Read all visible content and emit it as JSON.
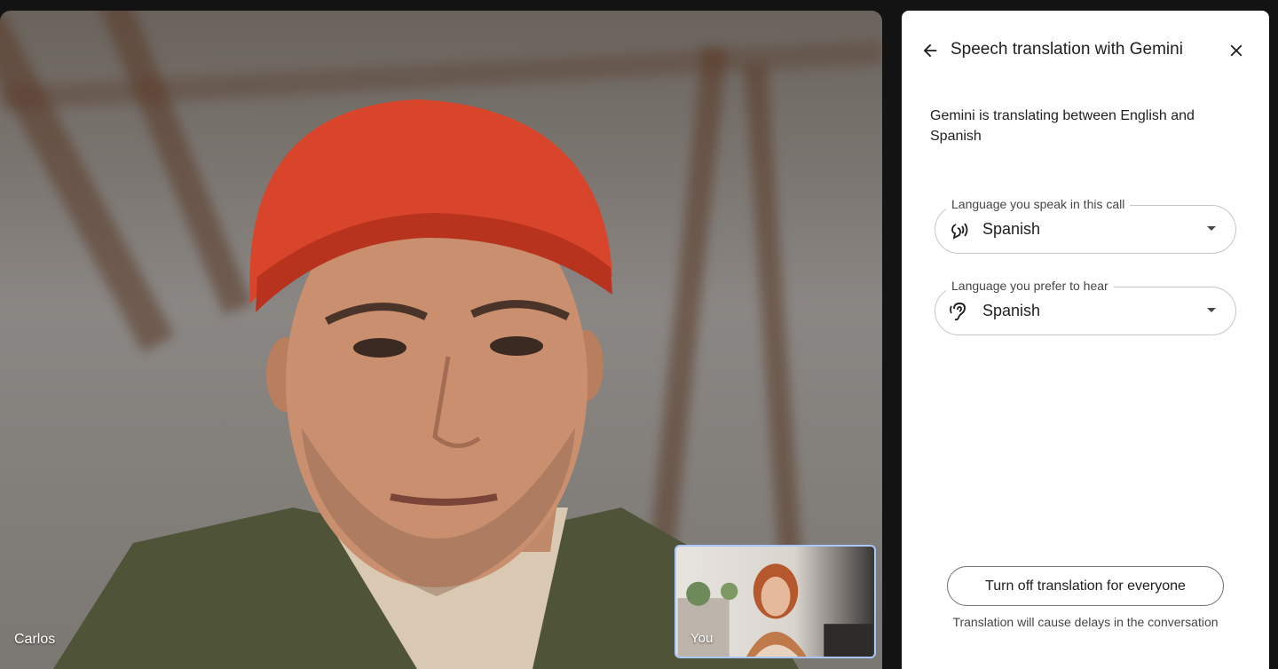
{
  "main_tile": {
    "name": "Carlos"
  },
  "self_tile": {
    "name": "You"
  },
  "panel": {
    "back_icon": "arrow-back-icon",
    "title": "Speech translation with Gemini",
    "close_icon": "close-icon",
    "description": "Gemini is translating between English and Spanish",
    "speak_field": {
      "label": "Language you speak in this call",
      "icon": "speaking-icon",
      "value": "Spanish"
    },
    "hear_field": {
      "label": "Language you prefer to hear",
      "icon": "hearing-icon",
      "value": "Spanish"
    },
    "turn_off_label": "Turn off translation for everyone",
    "note": "Translation will cause delays in the conversation"
  },
  "colors": {
    "background": "#131314",
    "panel": "#ffffff",
    "self_view_border": "#a8c7fa"
  }
}
